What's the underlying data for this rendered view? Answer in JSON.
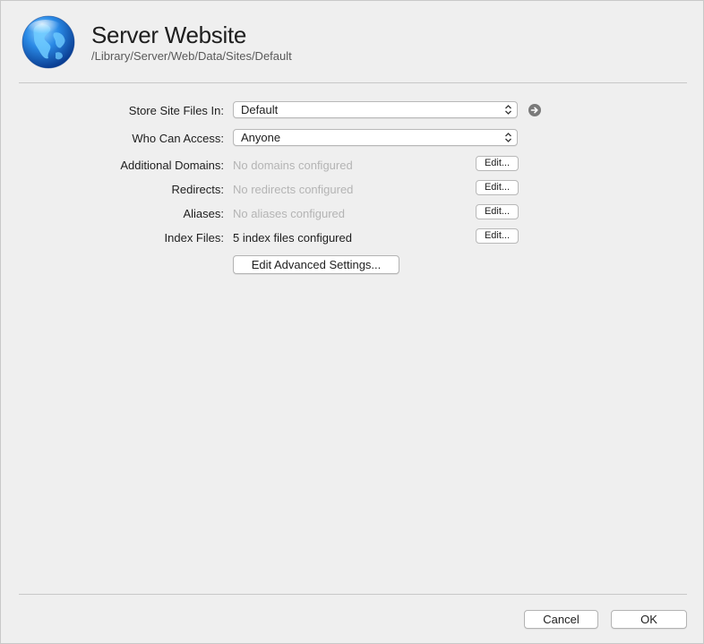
{
  "header": {
    "title": "Server Website",
    "path": "/Library/Server/Web/Data/Sites/Default",
    "icon": "globe-icon"
  },
  "form": {
    "store_files": {
      "label": "Store Site Files In:",
      "value": "Default"
    },
    "who_can_access": {
      "label": "Who Can Access:",
      "value": "Anyone"
    },
    "additional_domains": {
      "label": "Additional Domains:",
      "value": "No domains configured",
      "edit_label": "Edit..."
    },
    "redirects": {
      "label": "Redirects:",
      "value": "No redirects configured",
      "edit_label": "Edit..."
    },
    "aliases": {
      "label": "Aliases:",
      "value": "No aliases configured",
      "edit_label": "Edit..."
    },
    "index_files": {
      "label": "Index Files:",
      "value": "5 index files configured",
      "edit_label": "Edit..."
    },
    "advanced_label": "Edit Advanced Settings..."
  },
  "footer": {
    "cancel_label": "Cancel",
    "ok_label": "OK"
  },
  "colors": {
    "background": "#efefef",
    "dim_text": "#b4b4b4",
    "globe_blue": "#1a6fd1"
  }
}
